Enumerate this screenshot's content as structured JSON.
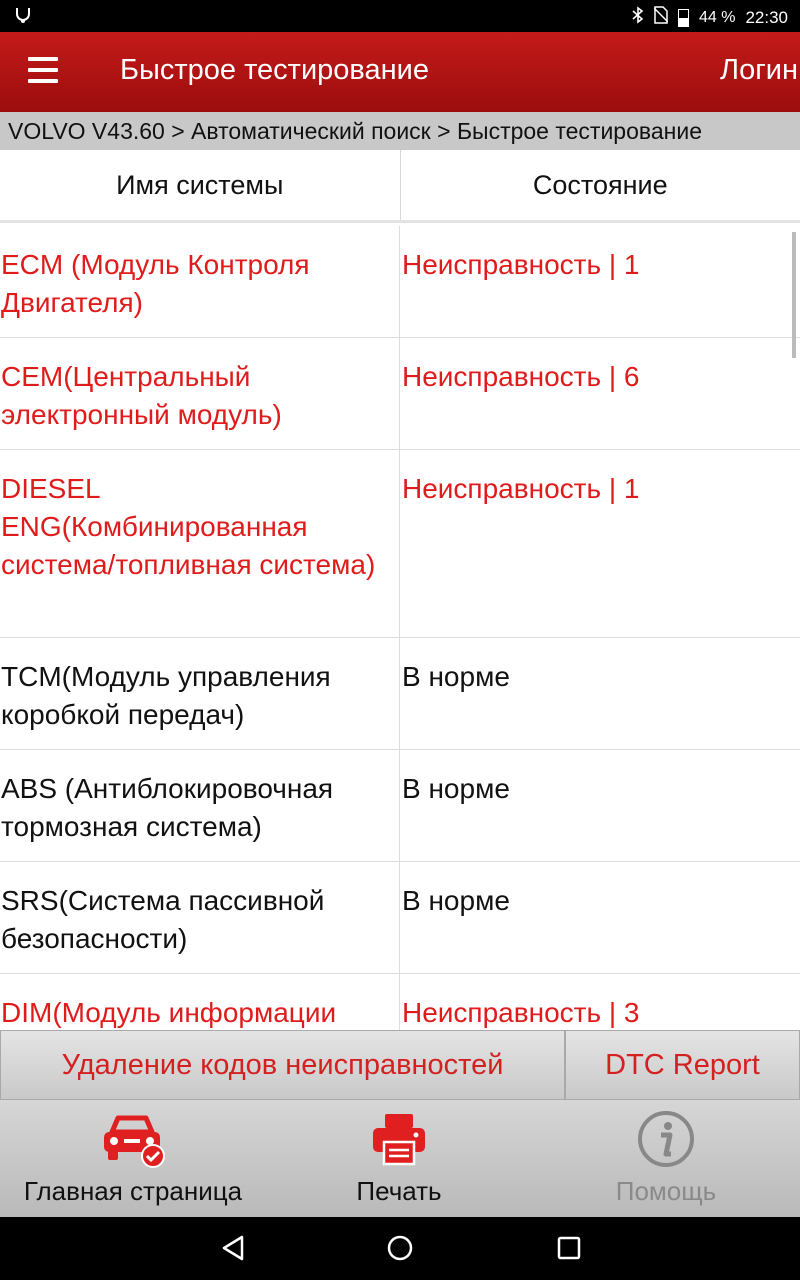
{
  "status_bar": {
    "battery": "44 %",
    "time": "22:30",
    "icons": [
      "usb-debug-icon",
      "bluetooth-icon",
      "no-sim-icon",
      "battery-icon"
    ]
  },
  "app_bar": {
    "title": "Быстрое тестирование",
    "login": "Логин"
  },
  "breadcrumb": "VOLVO V43.60 > Автоматический поиск > Быстрое тестирование",
  "table": {
    "headers": [
      "Имя системы",
      "Состояние"
    ],
    "rows": [
      {
        "name": "ECM (Модуль Контроля Двигателя)",
        "status": "Неисправность  | 1",
        "fault": true
      },
      {
        "name": "CEM(Центральный электронный модуль)",
        "status": "Неисправность  | 6",
        "fault": true
      },
      {
        "name": "DIESEL ENG(Комбинированная система/топливная система)",
        "status": "Неисправность  | 1",
        "fault": true
      },
      {
        "name": "TCM(Модуль управления коробкой передач)",
        "status": "В норме",
        "fault": false
      },
      {
        "name": "ABS (Антиблокировочная тормозная система)",
        "status": "В норме",
        "fault": false
      },
      {
        "name": "SRS(Система пассивной безопасности)",
        "status": "В норме",
        "fault": false
      },
      {
        "name": "DIM(Модуль информации",
        "status": "Неисправность  | 3",
        "fault": true
      }
    ]
  },
  "actions": {
    "clear_codes": "Удаление кодов неисправностей",
    "dtc_report": "DTC Report"
  },
  "bottom_nav": {
    "home": "Главная страница",
    "print": "Печать",
    "help": "Помощь"
  },
  "colors": {
    "accent": "#b3120f",
    "fault_text": "#e01b1b",
    "normal_text": "#111111"
  }
}
